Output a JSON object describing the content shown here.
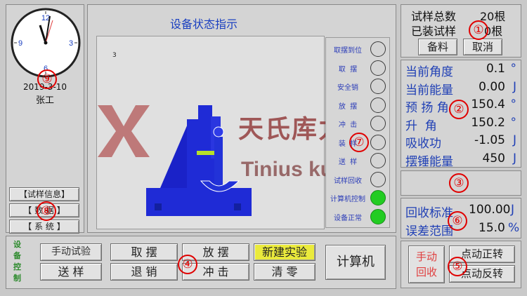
{
  "clock": {
    "date": "2019-3-10",
    "user": "张工",
    "numerals": [
      "12",
      "3",
      "6",
      "9"
    ],
    "numeral_color": "#1a3fc0"
  },
  "sidebar": {
    "items": [
      {
        "label": "【试样信息】"
      },
      {
        "label": "【 数 据 】"
      },
      {
        "label": "【 系 统 】"
      }
    ]
  },
  "center": {
    "title": "设备状态指示",
    "canvas_mark": "3",
    "watermark_cn": "天氏库力",
    "watermark_en": "Tinius kuli",
    "brand_color": "#a32626"
  },
  "indicators": [
    {
      "label": "取摆到位",
      "state": "off"
    },
    {
      "label": "取  摆",
      "state": "off"
    },
    {
      "label": "安全销",
      "state": "off"
    },
    {
      "label": "放  摆",
      "state": "off"
    },
    {
      "label": "冲  击",
      "state": "off"
    },
    {
      "label": "装  样",
      "state": "off"
    },
    {
      "label": "送  样",
      "state": "off"
    },
    {
      "label": "试样回收",
      "state": "off"
    },
    {
      "label": "计算机控制",
      "state": "on"
    },
    {
      "label": "设备正常",
      "state": "on"
    }
  ],
  "colors": {
    "indicator_on": "#22cc22",
    "indicator_off": "#d4d4d4",
    "marker": "#e00000",
    "machine": "#1f2bd6"
  },
  "sample": {
    "total_label": "试样总数",
    "total_value": "20根",
    "loaded_label": "已装试样",
    "loaded_value": "0根",
    "prepare_btn": "备料",
    "cancel_btn": "取消"
  },
  "readings": [
    {
      "label": "当前角度",
      "value": "0.1",
      "unit": "°"
    },
    {
      "label": "当前能量",
      "value": "0.00",
      "unit": "J"
    },
    {
      "label": "预 扬 角",
      "value": "150.4",
      "unit": "°"
    },
    {
      "label": "升  角",
      "value": "150.2",
      "unit": "°"
    },
    {
      "label": "吸收功",
      "value": "-1.05",
      "unit": "J"
    },
    {
      "label": "摆锤能量",
      "value": "450",
      "unit": "J"
    }
  ],
  "recovery": {
    "std_label": "回收标准",
    "std_value": "100.00",
    "std_unit": "J",
    "range_label": "误差范围",
    "range_value": "15.0",
    "range_unit": "%"
  },
  "manual": {
    "label_line1": "手动",
    "label_line2": "回收",
    "jog_forward": "点动正转",
    "jog_reverse": "点动反转"
  },
  "device_control": {
    "label": "设备控制",
    "manual_test": "手动试验",
    "feed_sample": "送 样",
    "pick": "取 摆",
    "retreat": "退 销",
    "release": "放 摆",
    "impact": "冲 击",
    "new_experiment": "新建实验",
    "clear": "清 零",
    "computer": "计算机"
  },
  "markers": [
    "①",
    "②",
    "③",
    "④",
    "⑤",
    "⑥",
    "⑦",
    "⑧",
    "⑨"
  ]
}
